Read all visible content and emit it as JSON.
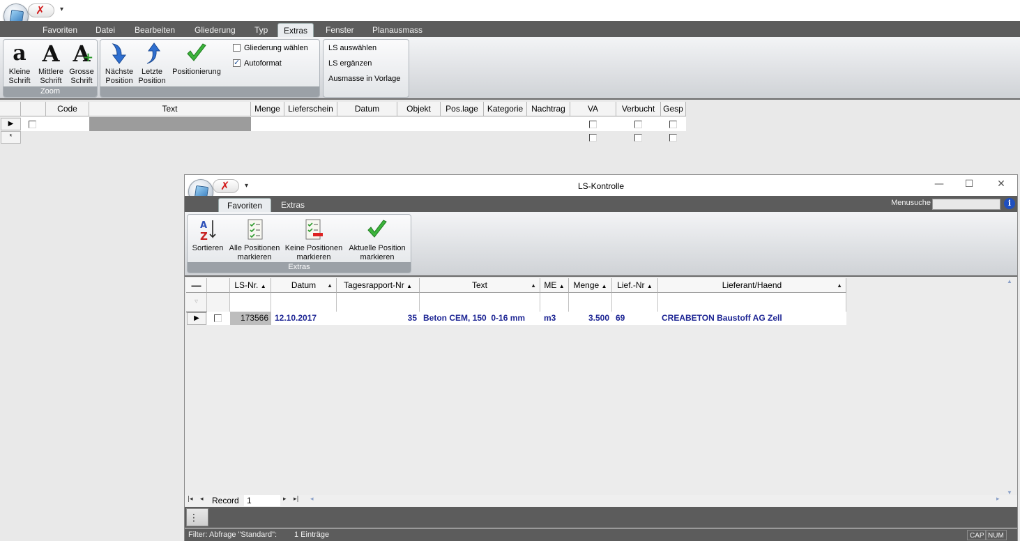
{
  "main": {
    "tabs": [
      "Favoriten",
      "Datei",
      "Bearbeiten",
      "Gliederung",
      "Typ",
      "Extras",
      "Fenster",
      "Planausmass"
    ],
    "active_tab": "Extras",
    "ribbon": {
      "zoom": {
        "label": "Zoom",
        "buttons": [
          {
            "icon": "small-font-icon",
            "line1": "Kleine",
            "line2": "Schrift"
          },
          {
            "icon": "medium-font-icon",
            "line1": "Mittlere",
            "line2": "Schrift"
          },
          {
            "icon": "large-font-icon",
            "line1": "Grosse",
            "line2": "Schrift"
          }
        ]
      },
      "position": {
        "buttons": [
          {
            "icon": "arrow-down-icon",
            "line1": "Nächste",
            "line2": "Position"
          },
          {
            "icon": "arrow-up-icon",
            "line1": "Letzte",
            "line2": "Position"
          },
          {
            "icon": "checkmark-icon",
            "line1": "Positionierung",
            "line2": ""
          }
        ],
        "checkboxes": [
          {
            "label": "Gliederung wählen",
            "checked": false
          },
          {
            "label": "Autoformat",
            "checked": true
          }
        ]
      },
      "ls": {
        "links": [
          "LS auswählen",
          "LS ergänzen",
          "Ausmasse in Vorlage"
        ]
      }
    },
    "grid": {
      "columns": [
        "",
        "Code",
        "Text",
        "Menge",
        "Lieferschein",
        "Datum",
        "Objekt",
        "Pos.lage",
        "Kategorie",
        "Nachtrag",
        "VA",
        "Verbucht",
        "Gesp"
      ],
      "new_row_marker": "*"
    }
  },
  "child": {
    "title": "LS-Kontrolle",
    "tabs": [
      "Favoriten",
      "Extras"
    ],
    "active_tab": "Favoriten",
    "search_label": "Menusuche",
    "ribbon": {
      "group_label": "Extras",
      "buttons": [
        {
          "icon": "sort-az-icon",
          "line1": "Sortieren",
          "line2": ""
        },
        {
          "icon": "select-all-icon",
          "line1": "Alle Positionen",
          "line2": "markieren"
        },
        {
          "icon": "select-none-icon",
          "line1": "Keine Positionen",
          "line2": "markieren"
        },
        {
          "icon": "checkmark-icon",
          "line1": "Aktuelle Position",
          "line2": "markieren"
        }
      ]
    },
    "grid": {
      "columns": [
        "LS-Nr.",
        "Datum",
        "Tagesrapport-Nr",
        "Text",
        "ME",
        "Menge",
        "Lief.-Nr",
        "Lieferant/Haend"
      ],
      "rows": [
        {
          "ls_nr": "173566",
          "datum": "12.10.2017",
          "tagesrapport": "35",
          "text": "Beton CEM, 150  0-16 mm",
          "me": "m3",
          "menge": "3.500",
          "lief_nr": "69",
          "lieferant": "CREABETON Baustoff AG Zell"
        }
      ]
    },
    "navigator": {
      "label": "Record",
      "value": "1"
    },
    "status": {
      "filter": "Filter: Abfrage \"Standard\":",
      "count": "1 Einträge",
      "cap": "CAP",
      "num": "NUM"
    }
  }
}
